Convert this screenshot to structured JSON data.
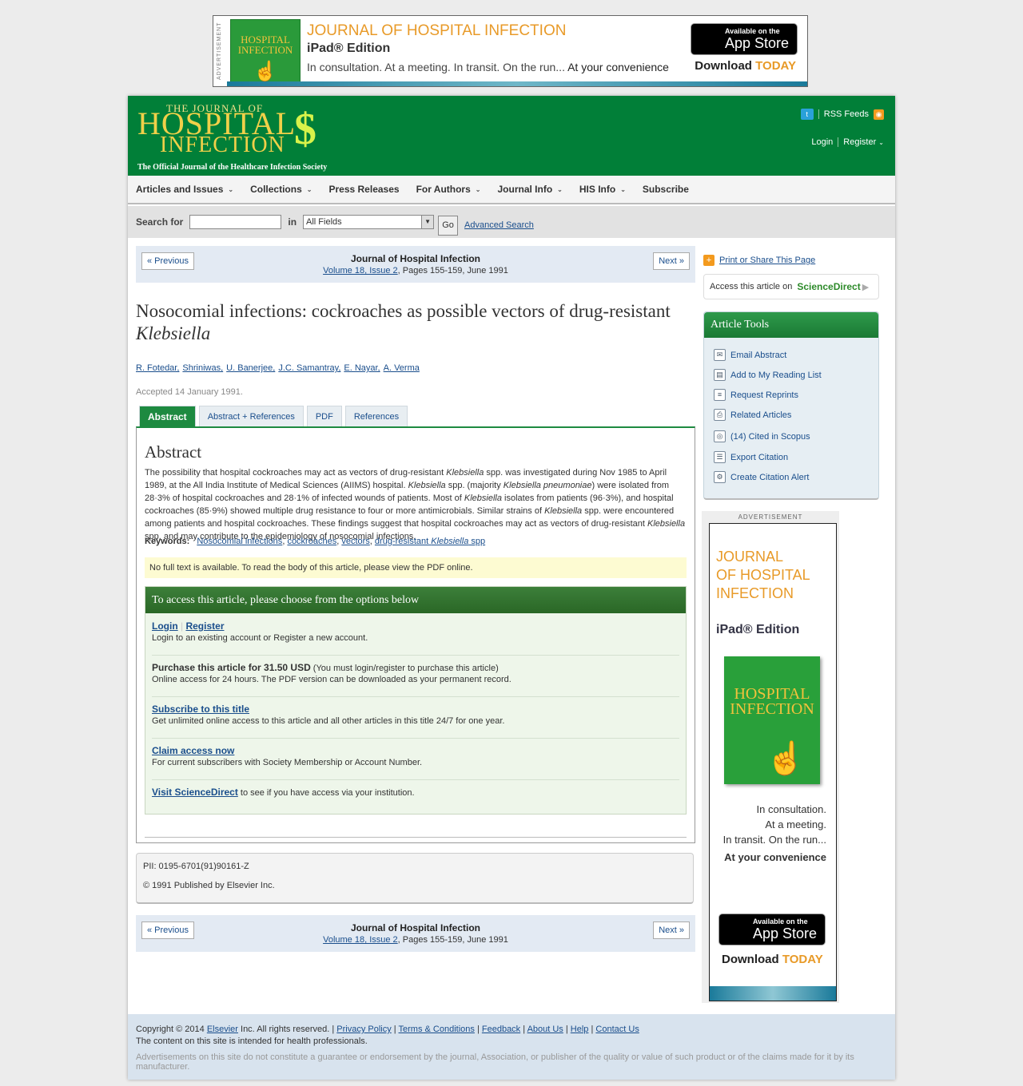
{
  "top_ad": {
    "side_label": "ADVERTISEMENT",
    "cover_title": "HOSPITAL INFECTION",
    "title": "JOURNAL OF HOSPITAL INFECTION",
    "edition": "iPad® Edition",
    "tagline_a": "In consultation. At a meeting. In transit. On the run...",
    "tagline_b": "At your convenience",
    "app_small": "Available on the",
    "app_big": "App Store",
    "download_a": "Download",
    "download_b": "TODAY"
  },
  "header": {
    "logo_small": "THE JOURNAL OF",
    "logo_big": "HOSPITAL",
    "logo_big2": "INFECTION",
    "logo_mark": "$",
    "logo_sub": "The Official Journal of the Healthcare Infection Society",
    "rss": "RSS Feeds",
    "login": "Login",
    "register": "Register"
  },
  "nav": [
    {
      "label": "Articles and Issues",
      "dropdown": true
    },
    {
      "label": "Collections",
      "dropdown": true
    },
    {
      "label": "Press Releases",
      "dropdown": false
    },
    {
      "label": "For Authors",
      "dropdown": true
    },
    {
      "label": "Journal Info",
      "dropdown": true
    },
    {
      "label": "HIS Info",
      "dropdown": true
    },
    {
      "label": "Subscribe",
      "dropdown": false
    }
  ],
  "search": {
    "label": "Search for",
    "in_label": "in",
    "field_value": "All Fields",
    "go": "Go",
    "advanced": "Advanced Search"
  },
  "pager": {
    "prev": "« Previous",
    "next": "Next »",
    "journal": "Journal of Hospital Infection",
    "volume_link": "Volume 18, Issue 2",
    "pages": ", Pages 155-159, June 1991"
  },
  "article": {
    "title_a": "Nosocomial infections: cockroaches as possible vectors of drug-resistant ",
    "title_b": "Klebsiella",
    "authors": [
      "R. Fotedar",
      "Shriniwas",
      "U. Banerjee",
      "J.C. Samantray",
      "E. Nayar",
      "A. Verma"
    ],
    "accepted": "Accepted 14 January 1991."
  },
  "tabs": [
    "Abstract",
    "Abstract + References",
    "PDF",
    "References"
  ],
  "abstract": {
    "heading": "Abstract",
    "text_parts": [
      "The possibility that hospital cockroaches may act as vectors of drug-resistant ",
      "Klebsiella",
      " spp. was investigated during Nov 1985 to April 1989, at the All India Institute of Medical Sciences (AIIMS) hospital. ",
      "Klebsiella",
      " spp. (majority ",
      "Klebsiella pneumoniae",
      ") were isolated from 28·3% of hospital cockroaches and 28·1% of infected wounds of patients. Most of ",
      "Klebsiella",
      " isolates from patients (96·3%), and hospital cockroaches (85·9%) showed multiple drug resistance to four or more antimicrobials. Similar strains of ",
      "Klebsiella",
      " spp. were encountered among patients and hospital cockroaches. These findings suggest that hospital cockroaches may act as vectors of drug-resistant ",
      "Klebsiella",
      " spp. and may contribute to the epidemiology of nosocomial infections."
    ],
    "keywords_label": "Keywords:",
    "keywords": [
      "Nosocomial infections",
      "cockroaches",
      "vectors"
    ],
    "keyword_last_a": "drug-resistant ",
    "keyword_last_b": "Klebsiella",
    "keyword_last_c": " spp",
    "no_full_text": "No full text is available. To read the body of this article, please view the PDF online."
  },
  "access": {
    "heading": "To access this article, please choose from the options below",
    "login": "Login",
    "register": "Register",
    "login_desc": "Login to an existing account or Register a new account.",
    "purchase": "Purchase this article for 31.50 USD",
    "purchase_note": " (You must login/register to purchase this article)",
    "purchase_desc": "Online access for 24 hours. The PDF version can be downloaded as your permanent record.",
    "subscribe": "Subscribe to this title",
    "subscribe_desc": "Get unlimited online access to this article and all other articles in this title 24/7 for one year.",
    "claim": "Claim access now",
    "claim_desc": "For current subscribers with Society Membership or Account Number.",
    "visit": "Visit ScienceDirect",
    "visit_desc": " to see if you have access via your institution."
  },
  "pii": {
    "pii": "PII: 0195-6701(91)90161-Z",
    "copyright": "© 1991 Published by Elsevier Inc."
  },
  "sidebar": {
    "print_share": "Print or Share This Page",
    "access_on": "Access this article on",
    "sciencedirect": "ScienceDirect",
    "tools_title": "Article Tools",
    "tools": [
      {
        "label": "Email Abstract",
        "icon": "email-icon"
      },
      {
        "label": "Add to My Reading List",
        "icon": "reading-list-icon"
      },
      {
        "label": "Request Reprints",
        "icon": "reprints-icon"
      },
      {
        "label": "Related Articles",
        "icon": "related-articles-icon"
      },
      {
        "label": "(14) Cited in Scopus",
        "icon": "scopus-icon"
      },
      {
        "label": "Export Citation",
        "icon": "export-citation-icon"
      },
      {
        "label": "Create Citation Alert",
        "icon": "citation-alert-icon"
      }
    ]
  },
  "side_ad": {
    "label": "ADVERTISEMENT",
    "title_1": "JOURNAL",
    "title_2": "OF HOSPITAL",
    "title_3": "INFECTION",
    "edition": "iPad® Edition",
    "cover_title": "HOSPITAL INFECTION",
    "tag1": "In consultation.",
    "tag2": "At a meeting.",
    "tag3": "In transit. On the run...",
    "tag4": "At your convenience",
    "app_small": "Available on the",
    "app_big": "App Store",
    "download_a": "Download",
    "download_b": "TODAY"
  },
  "footer": {
    "copyright_a": "Copyright © 2014 ",
    "elsevier": "Elsevier",
    "copyright_b": " Inc. All rights reserved. |",
    "links": [
      "Privacy Policy",
      "Terms & Conditions",
      "Feedback",
      "About Us",
      "Help",
      "Contact Us"
    ],
    "intended": "The content on this site is intended for health professionals.",
    "disclaimer": "Advertisements on this site do not constitute a guarantee or endorsement by the journal, Association, or publisher of the quality or value of such product or of the claims made for it by its manufacturer."
  },
  "colors": {
    "brand_green": "#017f38",
    "link_blue": "#1a4e8c",
    "accent_orange": "#e89a28"
  }
}
